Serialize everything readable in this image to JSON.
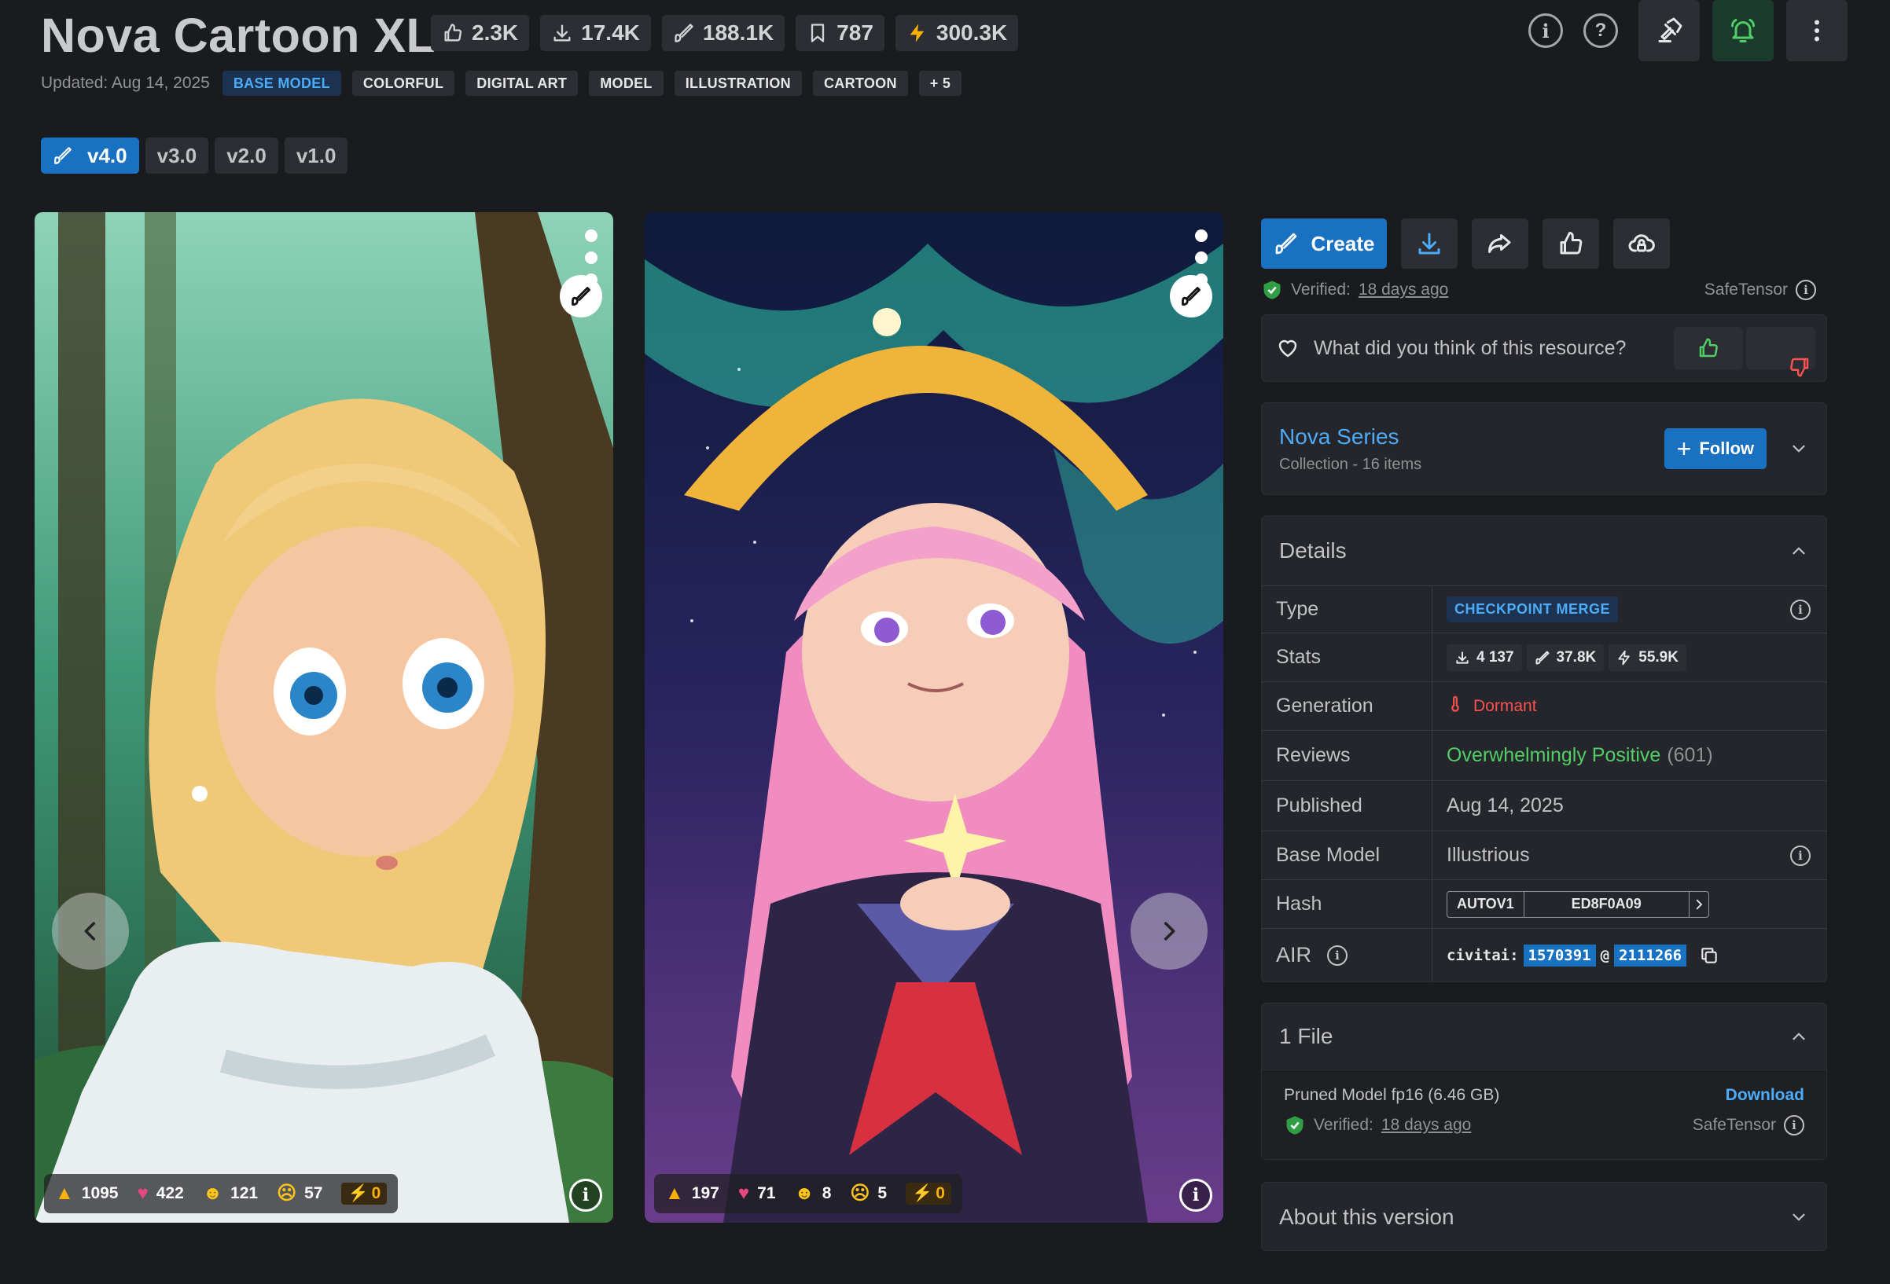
{
  "header": {
    "title": "Nova Cartoon XL",
    "stats": [
      {
        "icon": "thumbs-up-icon",
        "value": "2.3K"
      },
      {
        "icon": "download-icon",
        "value": "17.4K"
      },
      {
        "icon": "brush-icon",
        "value": "188.1K"
      },
      {
        "icon": "bookmark-icon",
        "value": "787"
      },
      {
        "icon": "bolt-icon",
        "value": "300.3K"
      }
    ],
    "updated": "Updated: Aug 14, 2025",
    "tags": [
      "BASE MODEL",
      "COLORFUL",
      "DIGITAL ART",
      "MODEL",
      "ILLUSTRATION",
      "CARTOON",
      "+ 5"
    ],
    "actions": [
      "info-icon",
      "help-icon",
      "gavel-icon",
      "bell-icon",
      "more-vertical-icon"
    ]
  },
  "versions": [
    "v4.0",
    "v3.0",
    "v2.0",
    "v1.0"
  ],
  "gallery": [
    {
      "reactions": {
        "like": "1095",
        "heart": "422",
        "laugh": "121",
        "cry": "57",
        "buzz": "0"
      }
    },
    {
      "reactions": {
        "like": "197",
        "heart": "71",
        "laugh": "8",
        "cry": "5",
        "buzz": "0"
      }
    }
  ],
  "sidebar": {
    "create_label": "Create",
    "verified_prefix": "Verified:",
    "verified_when": "18 days ago",
    "format": "SafeTensor",
    "feedback_question": "What did you think of this resource?",
    "collection": {
      "name": "Nova Series",
      "sub": "Collection - 16 items",
      "follow_label": "Follow"
    },
    "details": {
      "title": "Details",
      "rows": {
        "type_label": "Type",
        "type_value": "CHECKPOINT MERGE",
        "stats_label": "Stats",
        "stats_downloads": "4 137",
        "stats_generations": "37.8K",
        "stats_buzz": "55.9K",
        "generation_label": "Generation",
        "generation_value": "Dormant",
        "reviews_label": "Reviews",
        "reviews_value": "Overwhelmingly Positive",
        "reviews_count": "(601)",
        "published_label": "Published",
        "published_value": "Aug 14, 2025",
        "base_model_label": "Base Model",
        "base_model_value": "Illustrious",
        "hash_label": "Hash",
        "hash_type": "AUTOV1",
        "hash_value": "ED8F0A09",
        "air_label": "AIR",
        "air_prefix": "civitai:",
        "air_model": "1570391",
        "air_at": "@",
        "air_version": "2111266"
      }
    },
    "files": {
      "title": "1 File",
      "file_name": "Pruned Model fp16 (6.46 GB)",
      "download_label": "Download",
      "verified_prefix": "Verified:",
      "verified_when": "18 days ago",
      "format": "SafeTensor"
    },
    "about_title": "About this version"
  },
  "colors": {
    "background": "#1a1b1e",
    "panel": "#25262b",
    "accent": "#1971c2",
    "link": "#4dabf7",
    "positive": "#51cf66",
    "danger": "#fa5252"
  }
}
